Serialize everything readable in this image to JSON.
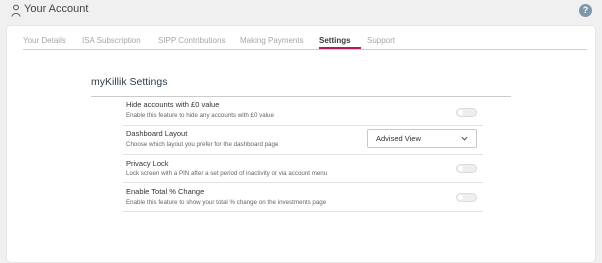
{
  "header": {
    "title": "Your Account",
    "help_label": "?"
  },
  "tabs": [
    {
      "label": "Your Details"
    },
    {
      "label": "ISA Subscription"
    },
    {
      "label": "SIPP Contributions"
    },
    {
      "label": "Making Payments"
    },
    {
      "label": "Settings",
      "active": true
    },
    {
      "label": "Support"
    }
  ],
  "settings": {
    "title": "myKillik Settings",
    "hide_zero": {
      "label": "Hide accounts with £0 value",
      "description": "Enable this feature to hide any accounts with £0 value",
      "enabled": false
    },
    "dashboard": {
      "label": "Dashboard Layout",
      "description": "Choose which layout you prefer for the dashboard page",
      "selected": "Advised View"
    },
    "privacy": {
      "label": "Privacy Lock",
      "description": "Lock screen with a PIN after a set period of inactivity or via account menu",
      "enabled": false
    },
    "total_change": {
      "label": "Enable Total % Change",
      "description": "Enable this feature to show your total % change on the investments page",
      "enabled": false
    }
  },
  "colors": {
    "accent": "#b7195e",
    "help": "#7f95a8"
  }
}
